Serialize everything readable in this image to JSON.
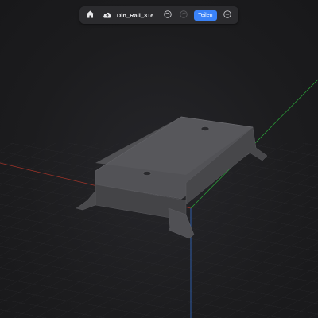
{
  "toolbar": {
    "home_icon": "home-icon",
    "cloud_icon": "cloud-upload-icon",
    "doc_title": "Din_Rail_3Te",
    "undo_icon": "undo-icon",
    "redo_icon": "redo-icon",
    "share_label": "Teilen",
    "more_icon": "more-options-icon"
  },
  "colors": {
    "background": "#1c1c1e",
    "toolbar_bg": "#2b2b2e",
    "accent": "#3a82f7",
    "axis_x": "#c0392b",
    "axis_y": "#2ecc40",
    "axis_z": "#3a82f7",
    "model": "#4d4d50"
  }
}
